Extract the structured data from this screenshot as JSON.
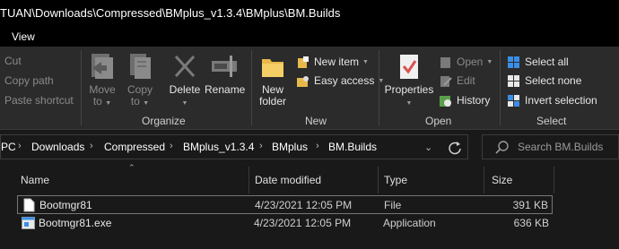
{
  "window": {
    "title": "TUAN\\Downloads\\Compressed\\BMplus_v1.3.4\\BMplus\\BM.Builds"
  },
  "menu": {
    "view_tab": "View"
  },
  "ribbon": {
    "clipboard": {
      "cut": "Cut",
      "copy_path": "Copy path",
      "paste_shortcut": "Paste shortcut"
    },
    "organize": {
      "label": "Organize",
      "move_to": [
        "Move",
        "to"
      ],
      "copy_to": [
        "Copy",
        "to"
      ],
      "delete": "Delete",
      "rename": "Rename"
    },
    "new": {
      "label": "New",
      "new_folder": [
        "New",
        "folder"
      ],
      "new_item": "New item",
      "easy_access": "Easy access"
    },
    "open": {
      "label": "Open",
      "properties": "Properties",
      "open": "Open",
      "edit": "Edit",
      "history": "History"
    },
    "select": {
      "label": "Select",
      "select_all": "Select all",
      "select_none": "Select none",
      "invert_selection": "Invert selection"
    }
  },
  "address": {
    "crumbs": [
      "PC",
      "Downloads",
      "Compressed",
      "BMplus_v1.3.4",
      "BMplus",
      "BM.Builds"
    ],
    "search_placeholder": "Search BM.Builds"
  },
  "columns": {
    "name": "Name",
    "date": "Date modified",
    "type": "Type",
    "size": "Size"
  },
  "files": [
    {
      "name": "Bootmgr81",
      "date": "4/23/2021 12:05 PM",
      "type": "File",
      "size": "391 KB",
      "icon": "blank-file-icon",
      "selected": true
    },
    {
      "name": "Bootmgr81.exe",
      "date": "4/23/2021 12:05 PM",
      "type": "Application",
      "size": "636 KB",
      "icon": "application-icon",
      "selected": false
    }
  ],
  "colors": {
    "ribbon_bg": "#2b2b2b",
    "titlebar_bg": "#000000",
    "content_bg": "#191919",
    "select_icon_blue": "#3a8ee6"
  }
}
